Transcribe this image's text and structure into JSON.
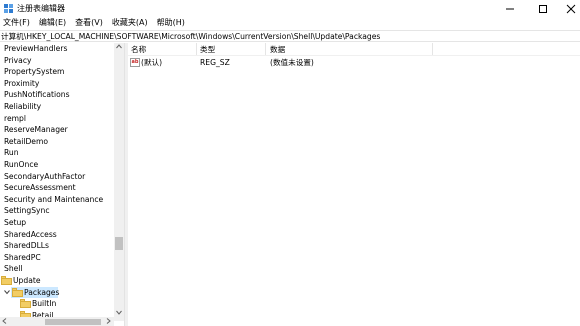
{
  "window": {
    "title": "注册表编辑器"
  },
  "menu": [
    {
      "label": "文件(F)"
    },
    {
      "label": "编辑(E)"
    },
    {
      "label": "查看(V)"
    },
    {
      "label": "收藏夹(A)"
    },
    {
      "label": "帮助(H)"
    }
  ],
  "address": "计算机\\HKEY_LOCAL_MACHINE\\SOFTWARE\\Microsoft\\Windows\\CurrentVersion\\Shell\\Update\\Packages",
  "tree": {
    "items": [
      {
        "label": "PreviewHandlers"
      },
      {
        "label": "Privacy"
      },
      {
        "label": "PropertySystem"
      },
      {
        "label": "Proximity"
      },
      {
        "label": "PushNotifications"
      },
      {
        "label": "Reliability"
      },
      {
        "label": "rempl"
      },
      {
        "label": "ReserveManager"
      },
      {
        "label": "RetailDemo"
      },
      {
        "label": "Run"
      },
      {
        "label": "RunOnce"
      },
      {
        "label": "SecondaryAuthFactor"
      },
      {
        "label": "SecureAssessment"
      },
      {
        "label": "Security and Maintenance"
      },
      {
        "label": "SettingSync"
      },
      {
        "label": "Setup"
      },
      {
        "label": "SharedAccess"
      },
      {
        "label": "SharedDLLs"
      },
      {
        "label": "SharedPC"
      },
      {
        "label": "Shell"
      }
    ],
    "update": {
      "label": "Update"
    },
    "packages": {
      "label": "Packages"
    },
    "children": [
      {
        "label": "BuiltIn"
      },
      {
        "label": "Retail"
      }
    ]
  },
  "list": {
    "columns": {
      "name": "名称",
      "type": "类型",
      "data": "数据"
    },
    "rows": [
      {
        "name": "(默认)",
        "type": "REG_SZ",
        "data": "(数值未设置)",
        "icon": "ab-string-icon"
      }
    ]
  },
  "colors": {
    "selection": "#cce8ff",
    "folder": "#f2cd64",
    "icon_blue": "#2e7bd0"
  }
}
